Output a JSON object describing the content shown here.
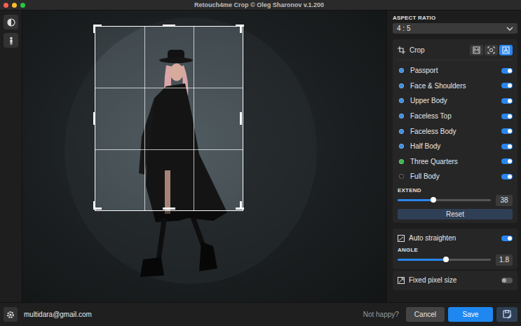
{
  "window": {
    "title": "Retouch4me Crop © Oleg Sharonov v.1.200"
  },
  "aspect_ratio": {
    "label": "ASPECT RATIO",
    "value": "4 : 5"
  },
  "crop": {
    "title": "Crop",
    "modes": [
      {
        "selected": false
      },
      {
        "selected": false
      },
      {
        "selected": true
      }
    ],
    "items": [
      {
        "label": "Passport",
        "color": "#3b8de0",
        "on": true
      },
      {
        "label": "Face & Shoulders",
        "color": "#3b8de0",
        "on": true
      },
      {
        "label": "Upper Body",
        "color": "#3b8de0",
        "on": true
      },
      {
        "label": "Faceless Top",
        "color": "#3b8de0",
        "on": true
      },
      {
        "label": "Faceless Body",
        "color": "#3b8de0",
        "on": true
      },
      {
        "label": "Half Body",
        "color": "#3b8de0",
        "on": true
      },
      {
        "label": "Three Quarters",
        "color": "#3bb54a",
        "on": true
      },
      {
        "label": "Full Body",
        "color": "#1e1e1e",
        "on": true
      }
    ],
    "extend": {
      "label": "EXTEND",
      "level": 0.38,
      "value": "38"
    },
    "reset": "Reset"
  },
  "straighten": {
    "label": "Auto straighten",
    "on": true,
    "angle": {
      "label": "ANGLE",
      "level": 0.52,
      "value": "1.8"
    }
  },
  "fixed_pixel_size": {
    "label": "Fixed pixel size",
    "on": false
  },
  "footer": {
    "email": "multidara@gmail.com",
    "prompt": "Not happy?",
    "buttons": [
      {
        "label": "Cancel",
        "primary": false
      },
      {
        "label": "Save",
        "primary": true
      }
    ]
  }
}
